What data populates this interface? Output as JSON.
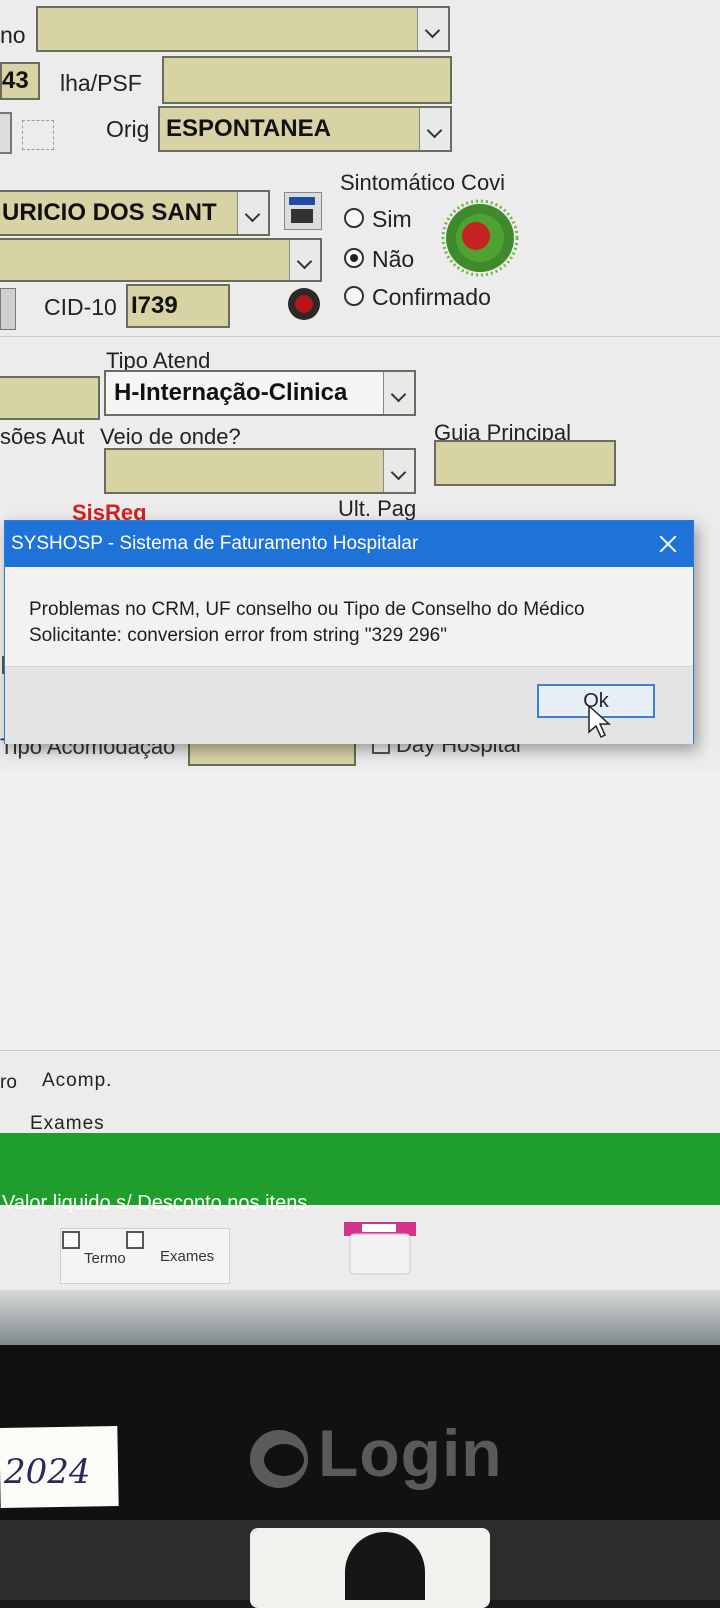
{
  "form": {
    "field1_label": "no",
    "counter_value": "43",
    "ilha_label": "lha/PSF",
    "orig_label": "Orig",
    "orig_value": "ESPONTANEA",
    "doctor_value": "URICIO DOS SANT",
    "cid_label": "CID-10",
    "cid_value": "I739",
    "covid_title": "Sintomático Covi",
    "covid_options": [
      "Sim",
      "Não",
      "Confirmado"
    ],
    "covid_selected": "Não",
    "tipo_atend_label": "Tipo Atend",
    "tipo_atend_value": "H-Internação-Clinica",
    "aut_label": "sões Aut",
    "veio_label": "Veio de onde?",
    "guia_label": "Guia Principal",
    "sisreg_label": "SisReg",
    "ultpag_label": "Ult. Pag",
    "tipo_acomod_label": "Tipo Acomodação",
    "day_hospital_label": "Day Hospital",
    "acomp_prefix": "ro",
    "acomp_label": "Acomp.",
    "exames_label": "Exames",
    "valor_liquido_label": "Valor liquido s/ Desconto nos itens",
    "termo_label": "Termo",
    "exames_label2": "Exames"
  },
  "dialog": {
    "title": "SYSHOSP - Sistema de Faturamento Hospitalar",
    "message": "Problemas no CRM, UF conselho ou Tipo de Conselho do Médico Solicitante: conversion error from string \"329 296\"",
    "ok_label": "Ok"
  },
  "monitor": {
    "brand": "Login",
    "sticky_note": "2024"
  },
  "colors": {
    "field_bg": "#d8d3a4",
    "dialog_title_bg": "#1f73d8",
    "green_bar": "#1f9e2b",
    "sisreg_red": "#d42020"
  }
}
